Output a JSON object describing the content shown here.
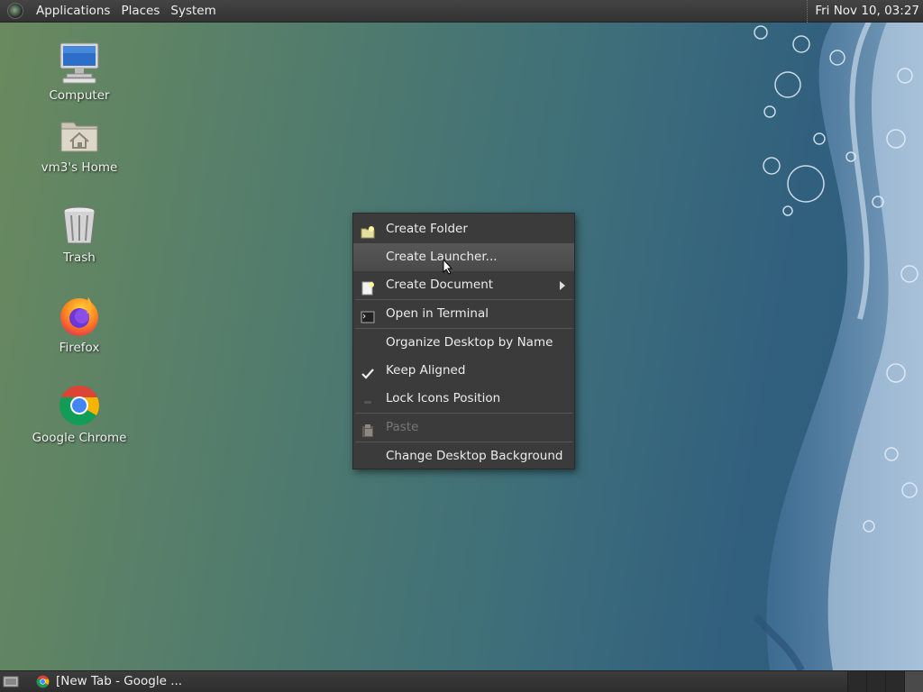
{
  "top_panel": {
    "menus": [
      "Applications",
      "Places",
      "System"
    ],
    "clock": "Fri Nov 10, 03:27"
  },
  "desktop_icons": [
    {
      "label": "Computer",
      "icon": "computer-icon"
    },
    {
      "label": "vm3's Home",
      "icon": "home-folder-icon"
    },
    {
      "label": "Trash",
      "icon": "trash-icon"
    },
    {
      "label": "Firefox",
      "icon": "firefox-icon"
    },
    {
      "label": "Google Chrome",
      "icon": "chrome-icon"
    }
  ],
  "context_menu": {
    "items": [
      {
        "label": "Create Folder",
        "icon": "folder-new-icon"
      },
      {
        "label": "Create Launcher...",
        "highlighted": true
      },
      {
        "label": "Create Document",
        "icon": "document-new-icon",
        "submenu": true
      },
      {
        "label": "Open in Terminal",
        "icon": "terminal-icon"
      },
      {
        "label": "Organize Desktop by Name"
      },
      {
        "label": "Keep Aligned",
        "checked": true
      },
      {
        "label": "Lock Icons Position",
        "checked": false
      },
      {
        "label": "Paste",
        "icon": "paste-icon",
        "disabled": true
      },
      {
        "label": "Change Desktop Background"
      }
    ]
  },
  "bottom_panel": {
    "task_label": "[New Tab - Google ...",
    "workspaces": 4,
    "active_workspace": 4
  }
}
